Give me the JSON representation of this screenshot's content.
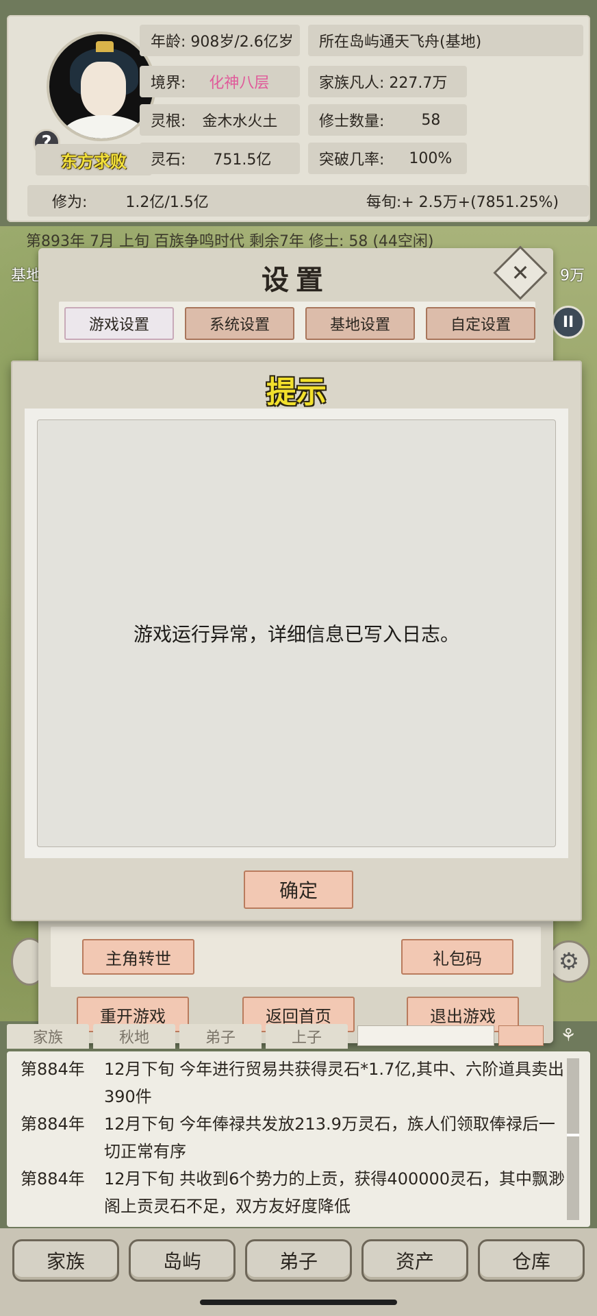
{
  "player": {
    "name": "东方求败",
    "help_icon": "?"
  },
  "stats": {
    "age": "年龄: 908岁/2.6亿岁",
    "location": "所在岛屿通天飞舟(基地)",
    "realm_label": "境界:",
    "realm_value": "化神八层",
    "family": "家族凡人:   227.7万",
    "root_label": "灵根:",
    "root_value": "金木水火土",
    "cultivators_label": "修士数量:",
    "cultivators_value": "58",
    "stones_label": "灵石:",
    "stones_value": "751.5亿",
    "breakthrough_label": "突破几率:",
    "breakthrough_value": "100%",
    "cultivation_label": "修为:",
    "cultivation_value": "1.2亿/1.5亿",
    "per_period": "每旬:+ 2.5万+(7851.25%)"
  },
  "era_line": "第893年 7月 上旬  百族争鸣时代 剩余7年  修士: 58 (44空闲)",
  "side": {
    "left_label": "基地",
    "right_label": "9万",
    "pause_icon": "II",
    "gear_icon": "⚙"
  },
  "settings": {
    "title": "设置",
    "close_icon": "✕",
    "tabs": [
      "游戏设置",
      "系统设置",
      "基地设置",
      "自定设置"
    ],
    "reborn_label": "主角转世",
    "gift_code_label": "礼包码",
    "restart_label": "重开游戏",
    "home_label": "返回首页",
    "quit_label": "退出游戏"
  },
  "dialog": {
    "title": "提示",
    "message": "游戏运行异常，详细信息已写入日志。",
    "confirm_label": "确定"
  },
  "log": {
    "tabs": [
      "家族",
      "秋地",
      "弟子",
      "上子"
    ],
    "entries": [
      {
        "year": "第884年",
        "text": "12月下旬 今年进行贸易共获得灵石*1.7亿,其中、六阶道具卖出390件"
      },
      {
        "year": "第884年",
        "text": "12月下旬 今年俸禄共发放213.9万灵石，族人们领取俸禄后一切正常有序"
      },
      {
        "year": "第884年",
        "text": "12月下旬 共收到6个势力的上贡，获得400000灵石，其中飘渺阁上贡灵石不足，双方友好度降低"
      }
    ]
  },
  "nav": [
    "家族",
    "岛屿",
    "弟子",
    "资产",
    "仓库"
  ]
}
